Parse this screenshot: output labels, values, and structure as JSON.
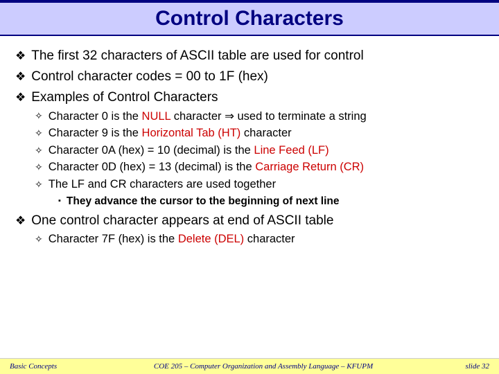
{
  "title": "Control Characters",
  "bullets": {
    "b1": "The first 32 characters of ASCII table are used for control",
    "b2": "Control character codes = 00 to 1F (hex)",
    "b3": "Examples of Control Characters",
    "b3_1_a": "Character 0 is the ",
    "b3_1_hl": "NULL",
    "b3_1_b": " character ",
    "b3_1_arrow": "⇒",
    "b3_1_c": " used to terminate a string",
    "b3_2_a": "Character 9 is the ",
    "b3_2_hl": "Horizontal Tab (HT)",
    "b3_2_b": " character",
    "b3_3_a": "Character 0A (hex) = 10 (decimal) is the ",
    "b3_3_hl": "Line Feed (LF)",
    "b3_4_a": "Character 0D (hex) = 13 (decimal) is the ",
    "b3_4_hl": "Carriage Return (CR)",
    "b3_5": "The LF and CR characters are used together",
    "b3_5_1": "They advance the cursor to the beginning of next line",
    "b4": "One control character appears at end of ASCII table",
    "b4_1_a": "Character 7F (hex) is the ",
    "b4_1_hl": "Delete (DEL)",
    "b4_1_b": " character"
  },
  "markers": {
    "l1": "❖",
    "l2": "✧",
    "l3": "▪"
  },
  "footer": {
    "left": "Basic Concepts",
    "center": "COE 205 – Computer Organization and Assembly Language – KFUPM",
    "right": "slide 32"
  }
}
